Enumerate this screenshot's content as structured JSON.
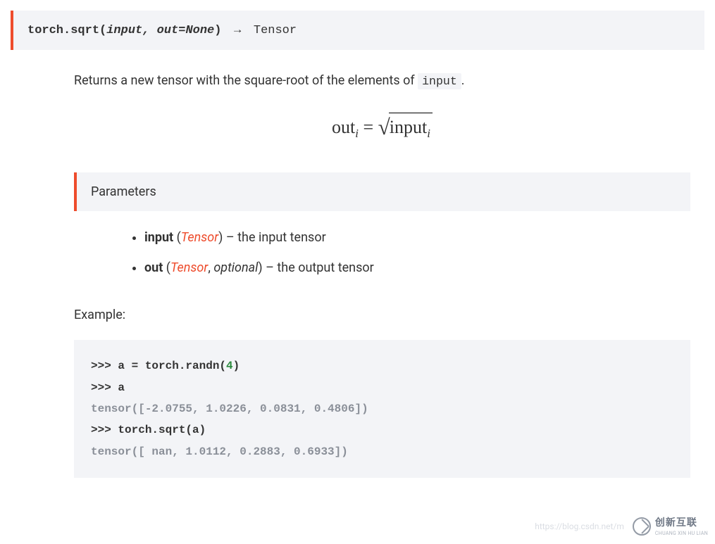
{
  "signature": {
    "qualname": "torch.sqrt",
    "open": "(",
    "params": "input, out=None",
    "close": ")",
    "arrow": "→",
    "returns": "Tensor"
  },
  "description": {
    "prefix": "Returns a new tensor with the square-root of the elements of ",
    "code": "input",
    "suffix": "."
  },
  "formula": {
    "lhs": "out",
    "sub_i": "i",
    "eq": " = ",
    "rhs": "input"
  },
  "params_heading": "Parameters",
  "parameters": [
    {
      "name": "input",
      "type": "Tensor",
      "optional": "",
      "desc": "the input tensor"
    },
    {
      "name": "out",
      "type": "Tensor",
      "optional": "optional",
      "desc": "the output tensor"
    }
  ],
  "example_label": "Example:",
  "code_example": {
    "lines": [
      {
        "prompt": ">>> ",
        "stmt_pre": "a = torch.randn(",
        "num": "4",
        "stmt_post": ")"
      },
      {
        "prompt": ">>> ",
        "stmt_pre": "a",
        "num": "",
        "stmt_post": ""
      },
      {
        "out": "tensor([-2.0755,  1.0226,  0.0831,  0.4806])"
      },
      {
        "prompt": ">>> ",
        "stmt_pre": "torch.sqrt(a)",
        "num": "",
        "stmt_post": ""
      },
      {
        "out": "tensor([    nan,  1.0112,  0.2883,  0.6933])"
      }
    ]
  },
  "watermark": {
    "url": "https://blog.csdn.net/m",
    "brand_cn": "创新互联",
    "brand_py": "CHUANG XIN HU LIAN"
  }
}
